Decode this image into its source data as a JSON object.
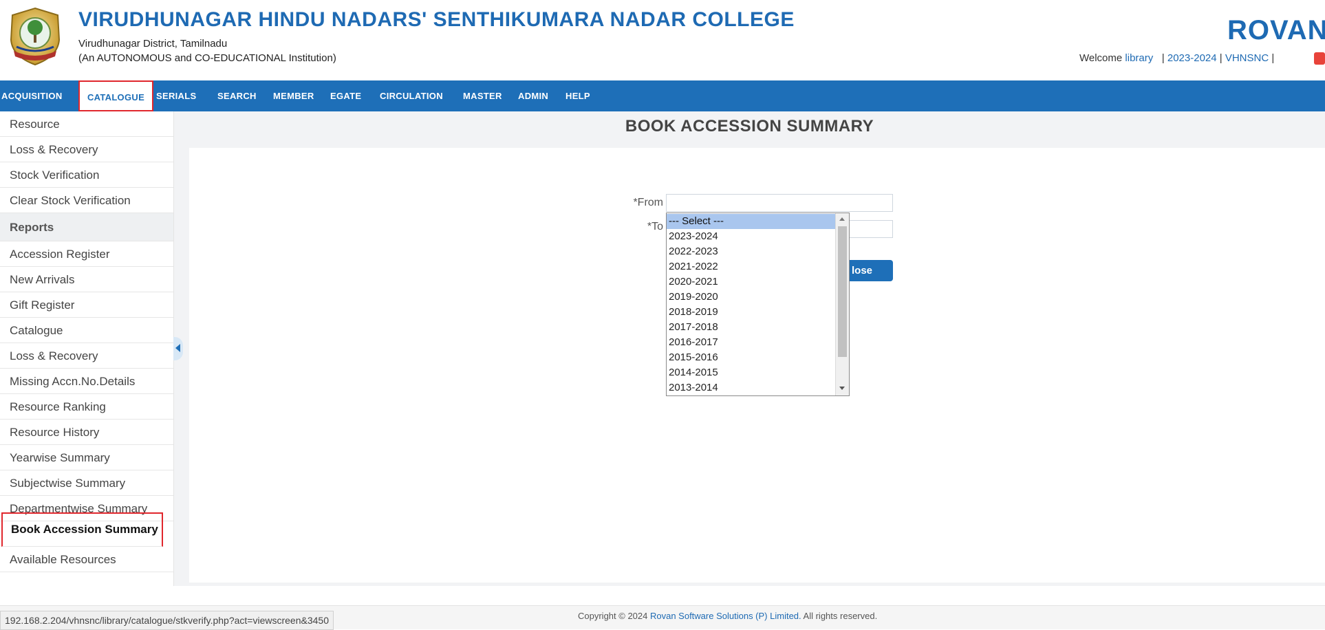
{
  "header": {
    "college_name": "VIRUDHUNAGAR HINDU NADARS' SENTHIKUMARA NADAR COLLEGE",
    "district": "Virudhunagar District, Tamilnadu",
    "institution_type": "(An AUTONOMOUS and CO-EDUCATIONAL Institution)",
    "brand": "ROVAN",
    "brand_mark": "®",
    "welcome_label": "Welcome",
    "username": "library",
    "year": "2023-2024",
    "institution_code": "VHNSNC",
    "separator": "|"
  },
  "nav": {
    "items": [
      {
        "label": "ACQUISITION"
      },
      {
        "label": "CATALOGUE"
      },
      {
        "label": "SERIALS"
      },
      {
        "label": "SEARCH"
      },
      {
        "label": "MEMBER"
      },
      {
        "label": "EGATE"
      },
      {
        "label": "CIRCULATION"
      },
      {
        "label": "MASTER"
      },
      {
        "label": "ADMIN"
      },
      {
        "label": "HELP"
      }
    ],
    "active": "CATALOGUE"
  },
  "sidebar": {
    "items": [
      {
        "label": "Resource"
      },
      {
        "label": "Loss & Recovery"
      },
      {
        "label": "Stock Verification"
      },
      {
        "label": "Clear Stock Verification"
      },
      {
        "label": "Reports"
      },
      {
        "label": "Accession Register"
      },
      {
        "label": "New Arrivals"
      },
      {
        "label": "Gift Register"
      },
      {
        "label": "Catalogue"
      },
      {
        "label": "Loss & Recovery"
      },
      {
        "label": "Missing Accn.No.Details"
      },
      {
        "label": "Resource Ranking"
      },
      {
        "label": "Resource History"
      },
      {
        "label": "Yearwise Summary"
      },
      {
        "label": "Subjectwise Summary"
      },
      {
        "label": "Departmentwise Summary"
      },
      {
        "label": "Book Accession Summary"
      },
      {
        "label": "Available Resources"
      }
    ]
  },
  "main": {
    "title": "BOOK ACCESSION SUMMARY",
    "from_label": "From",
    "to_label": "To",
    "required_mark": "*",
    "close_button": "lose"
  },
  "dropdown": {
    "options": [
      "--- Select ---",
      "2023-2024",
      "2022-2023",
      "2021-2022",
      "2020-2021",
      "2019-2020",
      "2018-2019",
      "2017-2018",
      "2016-2017",
      "2015-2016",
      "2014-2015",
      "2013-2014"
    ],
    "selected": "--- Select ---"
  },
  "footer": {
    "status_url": "192.168.2.204/vhnsnc/library/catalogue/stkverify.php?act=viewscreen&3450",
    "copyright_prefix": "Copyright © 2024",
    "company": "Rovan Software Solutions (P) Limited.",
    "copyright_suffix": "All rights reserved."
  },
  "colors": {
    "primary": "#1e6fb8",
    "highlight_box": "#e0262c",
    "selected_option": "#a9c6ee"
  }
}
